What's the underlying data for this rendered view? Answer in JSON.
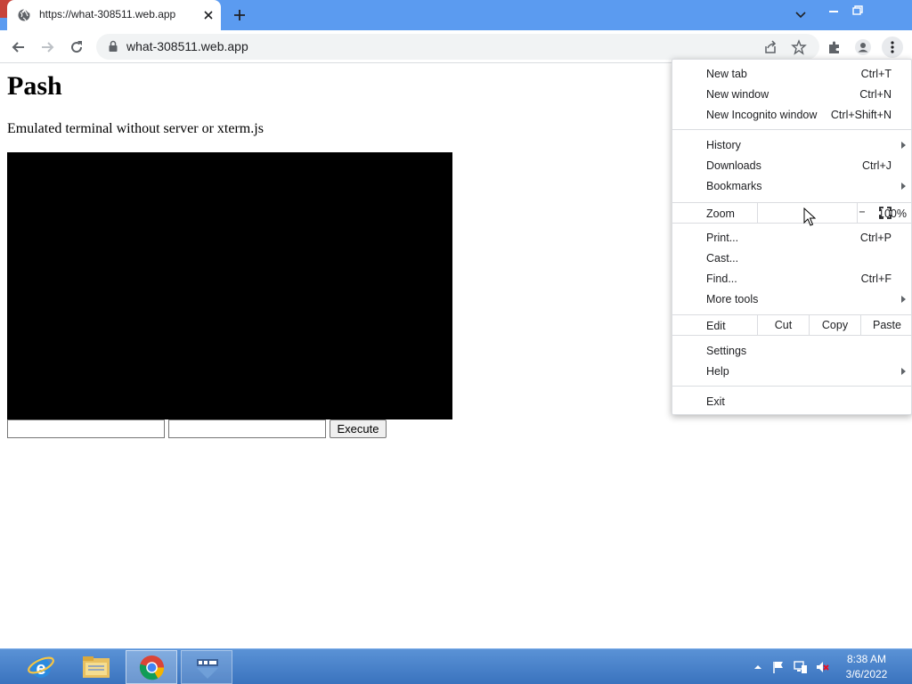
{
  "browser": {
    "tab_title": "https://what-308511.web.app",
    "url": "what-308511.web.app",
    "favicon": "globe-icon",
    "colors": {
      "titlebar": "#5b9bf0",
      "close": "#c7433a"
    }
  },
  "page": {
    "title": "Pash",
    "subtitle": "Emulated terminal without server or xterm.js",
    "input1_value": "",
    "input2_value": "",
    "execute_label": "Execute"
  },
  "menu": {
    "new_tab": {
      "label": "New tab",
      "shortcut": "Ctrl+T"
    },
    "new_window": {
      "label": "New window",
      "shortcut": "Ctrl+N"
    },
    "new_incognito": {
      "label": "New Incognito window",
      "shortcut": "Ctrl+Shift+N"
    },
    "history": {
      "label": "History"
    },
    "downloads": {
      "label": "Downloads",
      "shortcut": "Ctrl+J"
    },
    "bookmarks": {
      "label": "Bookmarks"
    },
    "zoom": {
      "label": "Zoom",
      "minus": "−",
      "value": "100%",
      "plus": "+"
    },
    "print": {
      "label": "Print...",
      "shortcut": "Ctrl+P"
    },
    "cast": {
      "label": "Cast..."
    },
    "find": {
      "label": "Find...",
      "shortcut": "Ctrl+F"
    },
    "more_tools": {
      "label": "More tools"
    },
    "edit": {
      "label": "Edit",
      "cut": "Cut",
      "copy": "Copy",
      "paste": "Paste"
    },
    "settings": {
      "label": "Settings"
    },
    "help": {
      "label": "Help"
    },
    "exit": {
      "label": "Exit"
    }
  },
  "taskbar": {
    "time": "8:38 AM",
    "date": "3/6/2022",
    "apps": [
      "internet-explorer-icon",
      "file-explorer-icon",
      "chrome-icon",
      "app-window-icon"
    ]
  }
}
